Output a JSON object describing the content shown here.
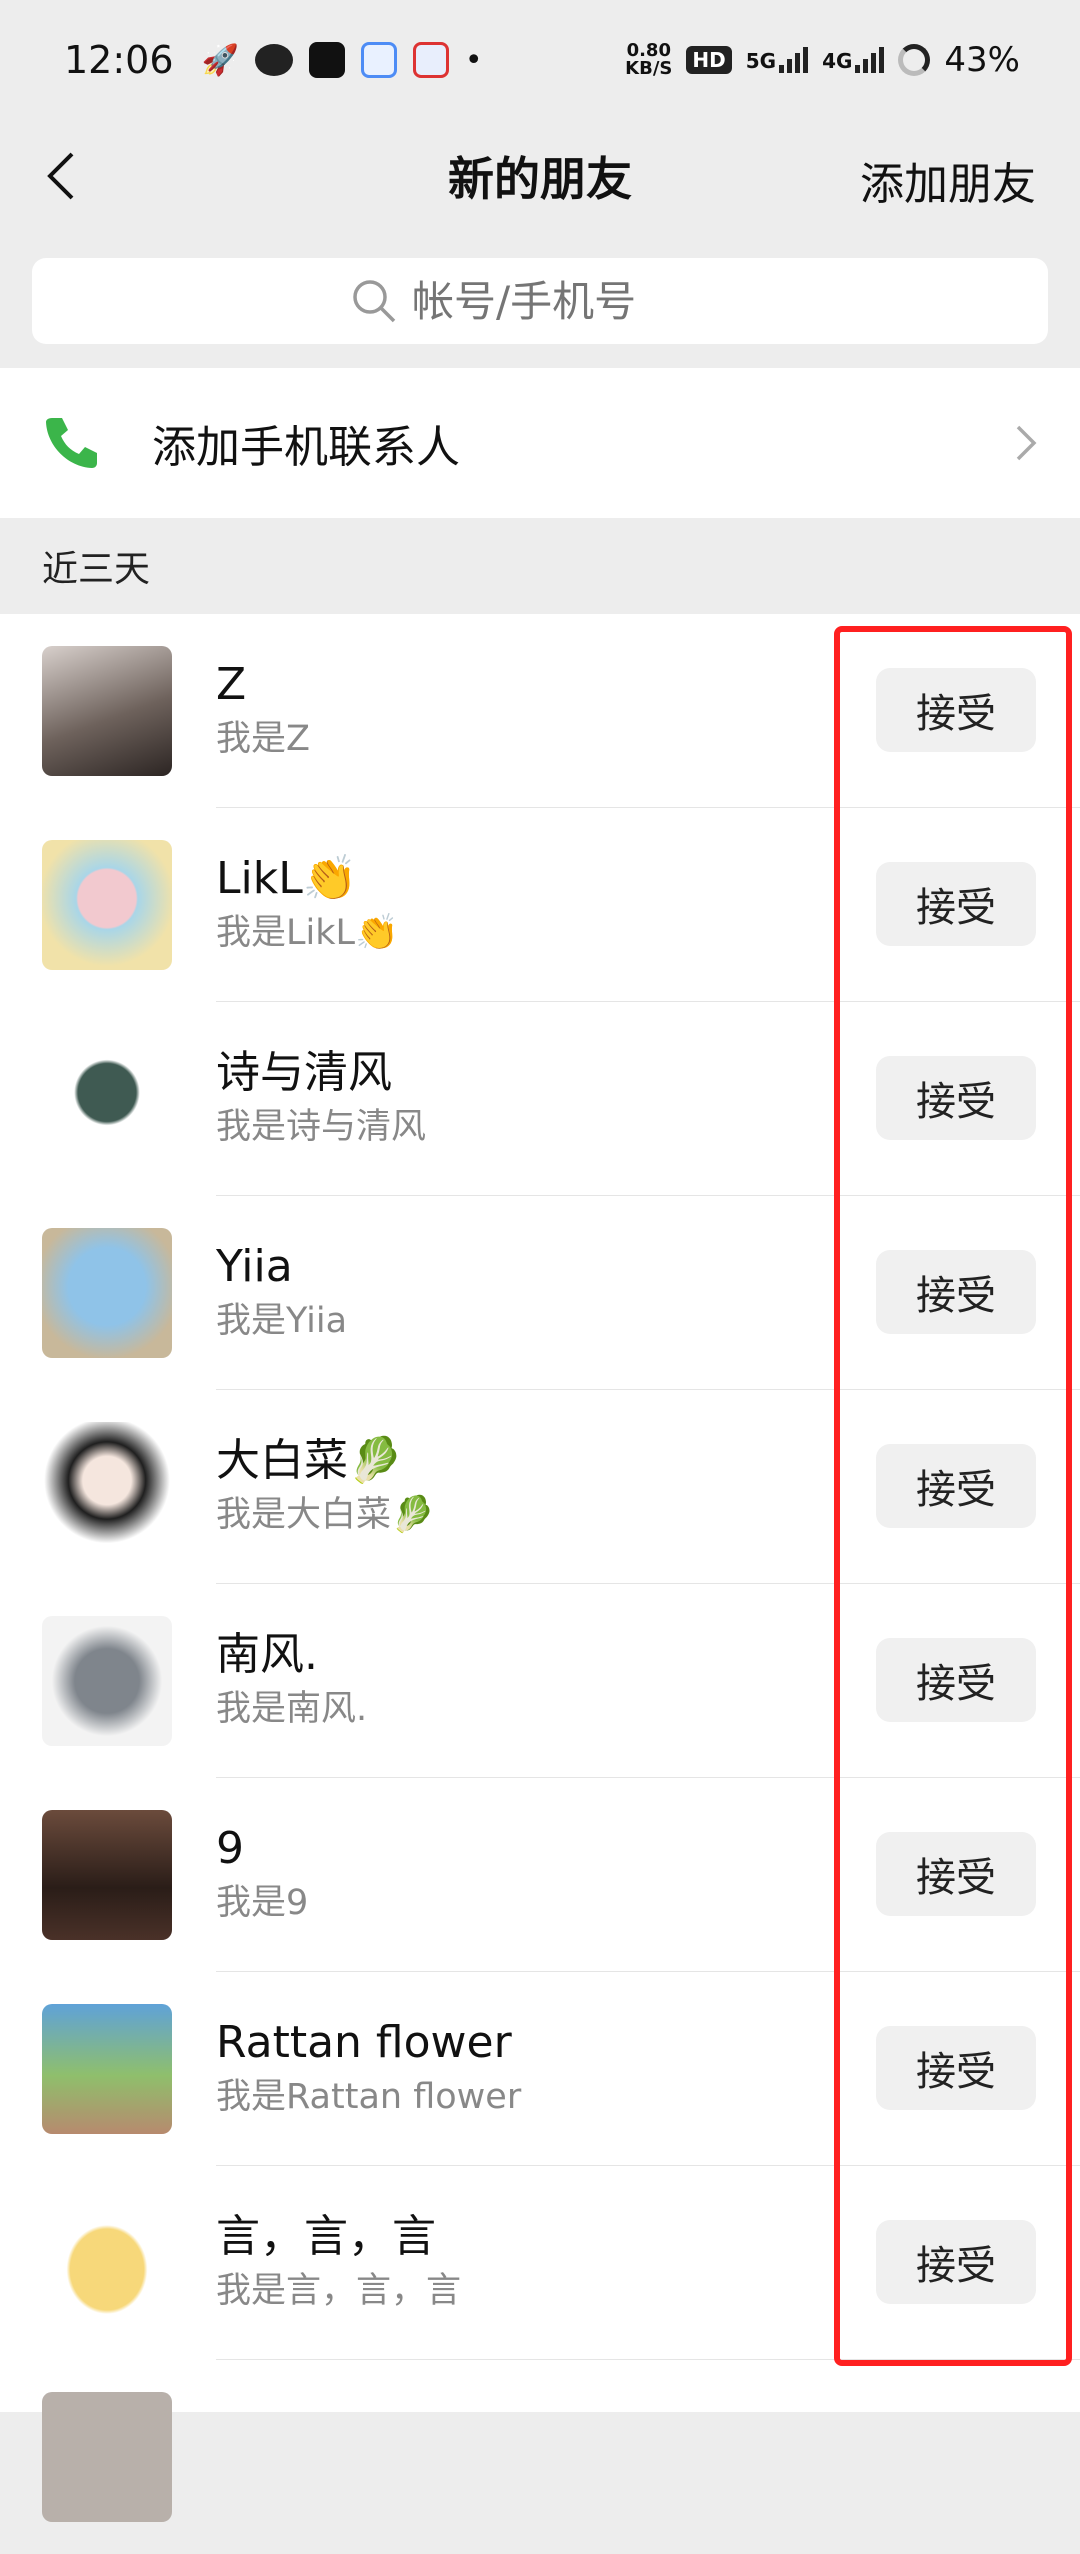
{
  "status": {
    "time": "12:06",
    "netspeed_value": "0.80",
    "netspeed_unit": "KB/S",
    "hd": "HD",
    "sig1": "5G",
    "sig2": "4G",
    "battery": "43%"
  },
  "nav": {
    "title": "新的朋友",
    "action": "添加朋友"
  },
  "search": {
    "placeholder": "帐号/手机号"
  },
  "add_contacts": {
    "label": "添加手机联系人"
  },
  "section": {
    "title": "近三天"
  },
  "requests": [
    {
      "name": "Z",
      "message": "我是Z",
      "button": "接受",
      "avatar_color": "#8a7f7a"
    },
    {
      "name": "LikL👏",
      "message": "我是LikL👏",
      "button": "接受",
      "avatar_color": "#e8b7c0"
    },
    {
      "name": "诗与清风",
      "message": "我是诗与清风",
      "button": "接受",
      "avatar_color": "#4f6b5f"
    },
    {
      "name": "Yiia",
      "message": "我是Yiia",
      "button": "接受",
      "avatar_color": "#9ec9ea"
    },
    {
      "name": "大白菜🥬",
      "message": "我是大白菜🥬",
      "button": "接受",
      "avatar_color": "#2b2b2b"
    },
    {
      "name": "南风.",
      "message": "我是南风.",
      "button": "接受",
      "avatar_color": "#7a7f86"
    },
    {
      "name": "9",
      "message": "我是9",
      "button": "接受",
      "avatar_color": "#3b2a24"
    },
    {
      "name": "Rattan flower",
      "message": "我是Rattan flower",
      "button": "接受",
      "avatar_color": "#6fa5d8"
    },
    {
      "name": "言，言，言",
      "message": "我是言，言，言",
      "button": "接受",
      "avatar_color": "#f7d87a"
    }
  ],
  "colors": {
    "accept_bg": "#f0f0f0",
    "highlight": "#ff2020",
    "phone_icon": "#3bb54a"
  }
}
